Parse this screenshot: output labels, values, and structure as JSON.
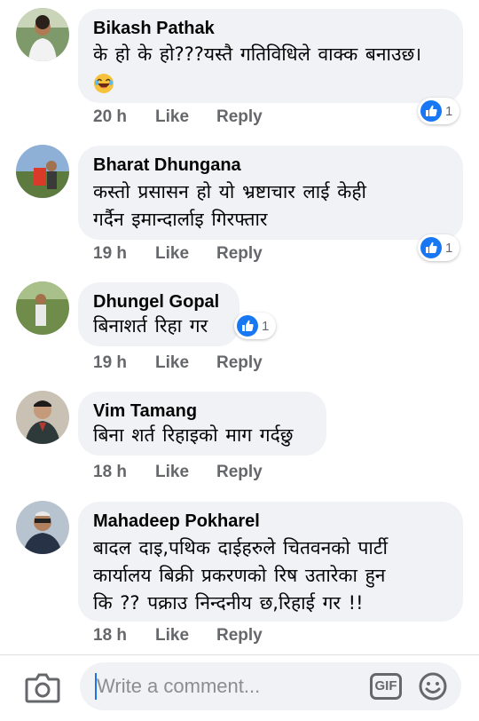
{
  "comments": [
    {
      "author": "Bikash Pathak",
      "text": "के हो के हो???यस्तै गतिविधिले वाक्क बनाउछ।",
      "emoji": "laughing-emoji",
      "time": "20 h",
      "like_label": "Like",
      "reply_label": "Reply",
      "reaction_count": "1"
    },
    {
      "author": "Bharat Dhungana",
      "text_lines": [
        "कस्तो प्रसासन हो यो भ्रष्टाचार  लाई केही",
        "गर्दैन इमान्दार्लाइ  गिरफ्तार"
      ],
      "time": "19 h",
      "like_label": "Like",
      "reply_label": "Reply",
      "reaction_count": "1"
    },
    {
      "author": "Dhungel Gopal",
      "text": "बिनाशर्त रिहा गर",
      "time": "19 h",
      "like_label": "Like",
      "reply_label": "Reply",
      "reaction_count": "1"
    },
    {
      "author": "Vim Tamang",
      "text": "बिना शर्त रिहाइको माग गर्दछु",
      "time": "18 h",
      "like_label": "Like",
      "reply_label": "Reply"
    },
    {
      "author": "Mahadeep Pokharel",
      "text_lines": [
        "बादल दाइ,पथिक दाईहरुले चितवनको पार्टी",
        "कार्यालय बिक्री प्रकरणको रिष उतारेका हुन",
        "कि ?? पक्राउ निन्दनीय छ,रिहाई गर !!"
      ],
      "time": "18 h",
      "like_label": "Like",
      "reply_label": "Reply"
    }
  ],
  "composer": {
    "placeholder": "Write a comment...",
    "gif_label": "GIF",
    "camera_icon": "camera-icon",
    "emoji_icon": "smiley-icon"
  },
  "colors": {
    "bubble": "#f0f2f5",
    "meta_text": "#65676b",
    "like_blue": "#1877f2"
  }
}
